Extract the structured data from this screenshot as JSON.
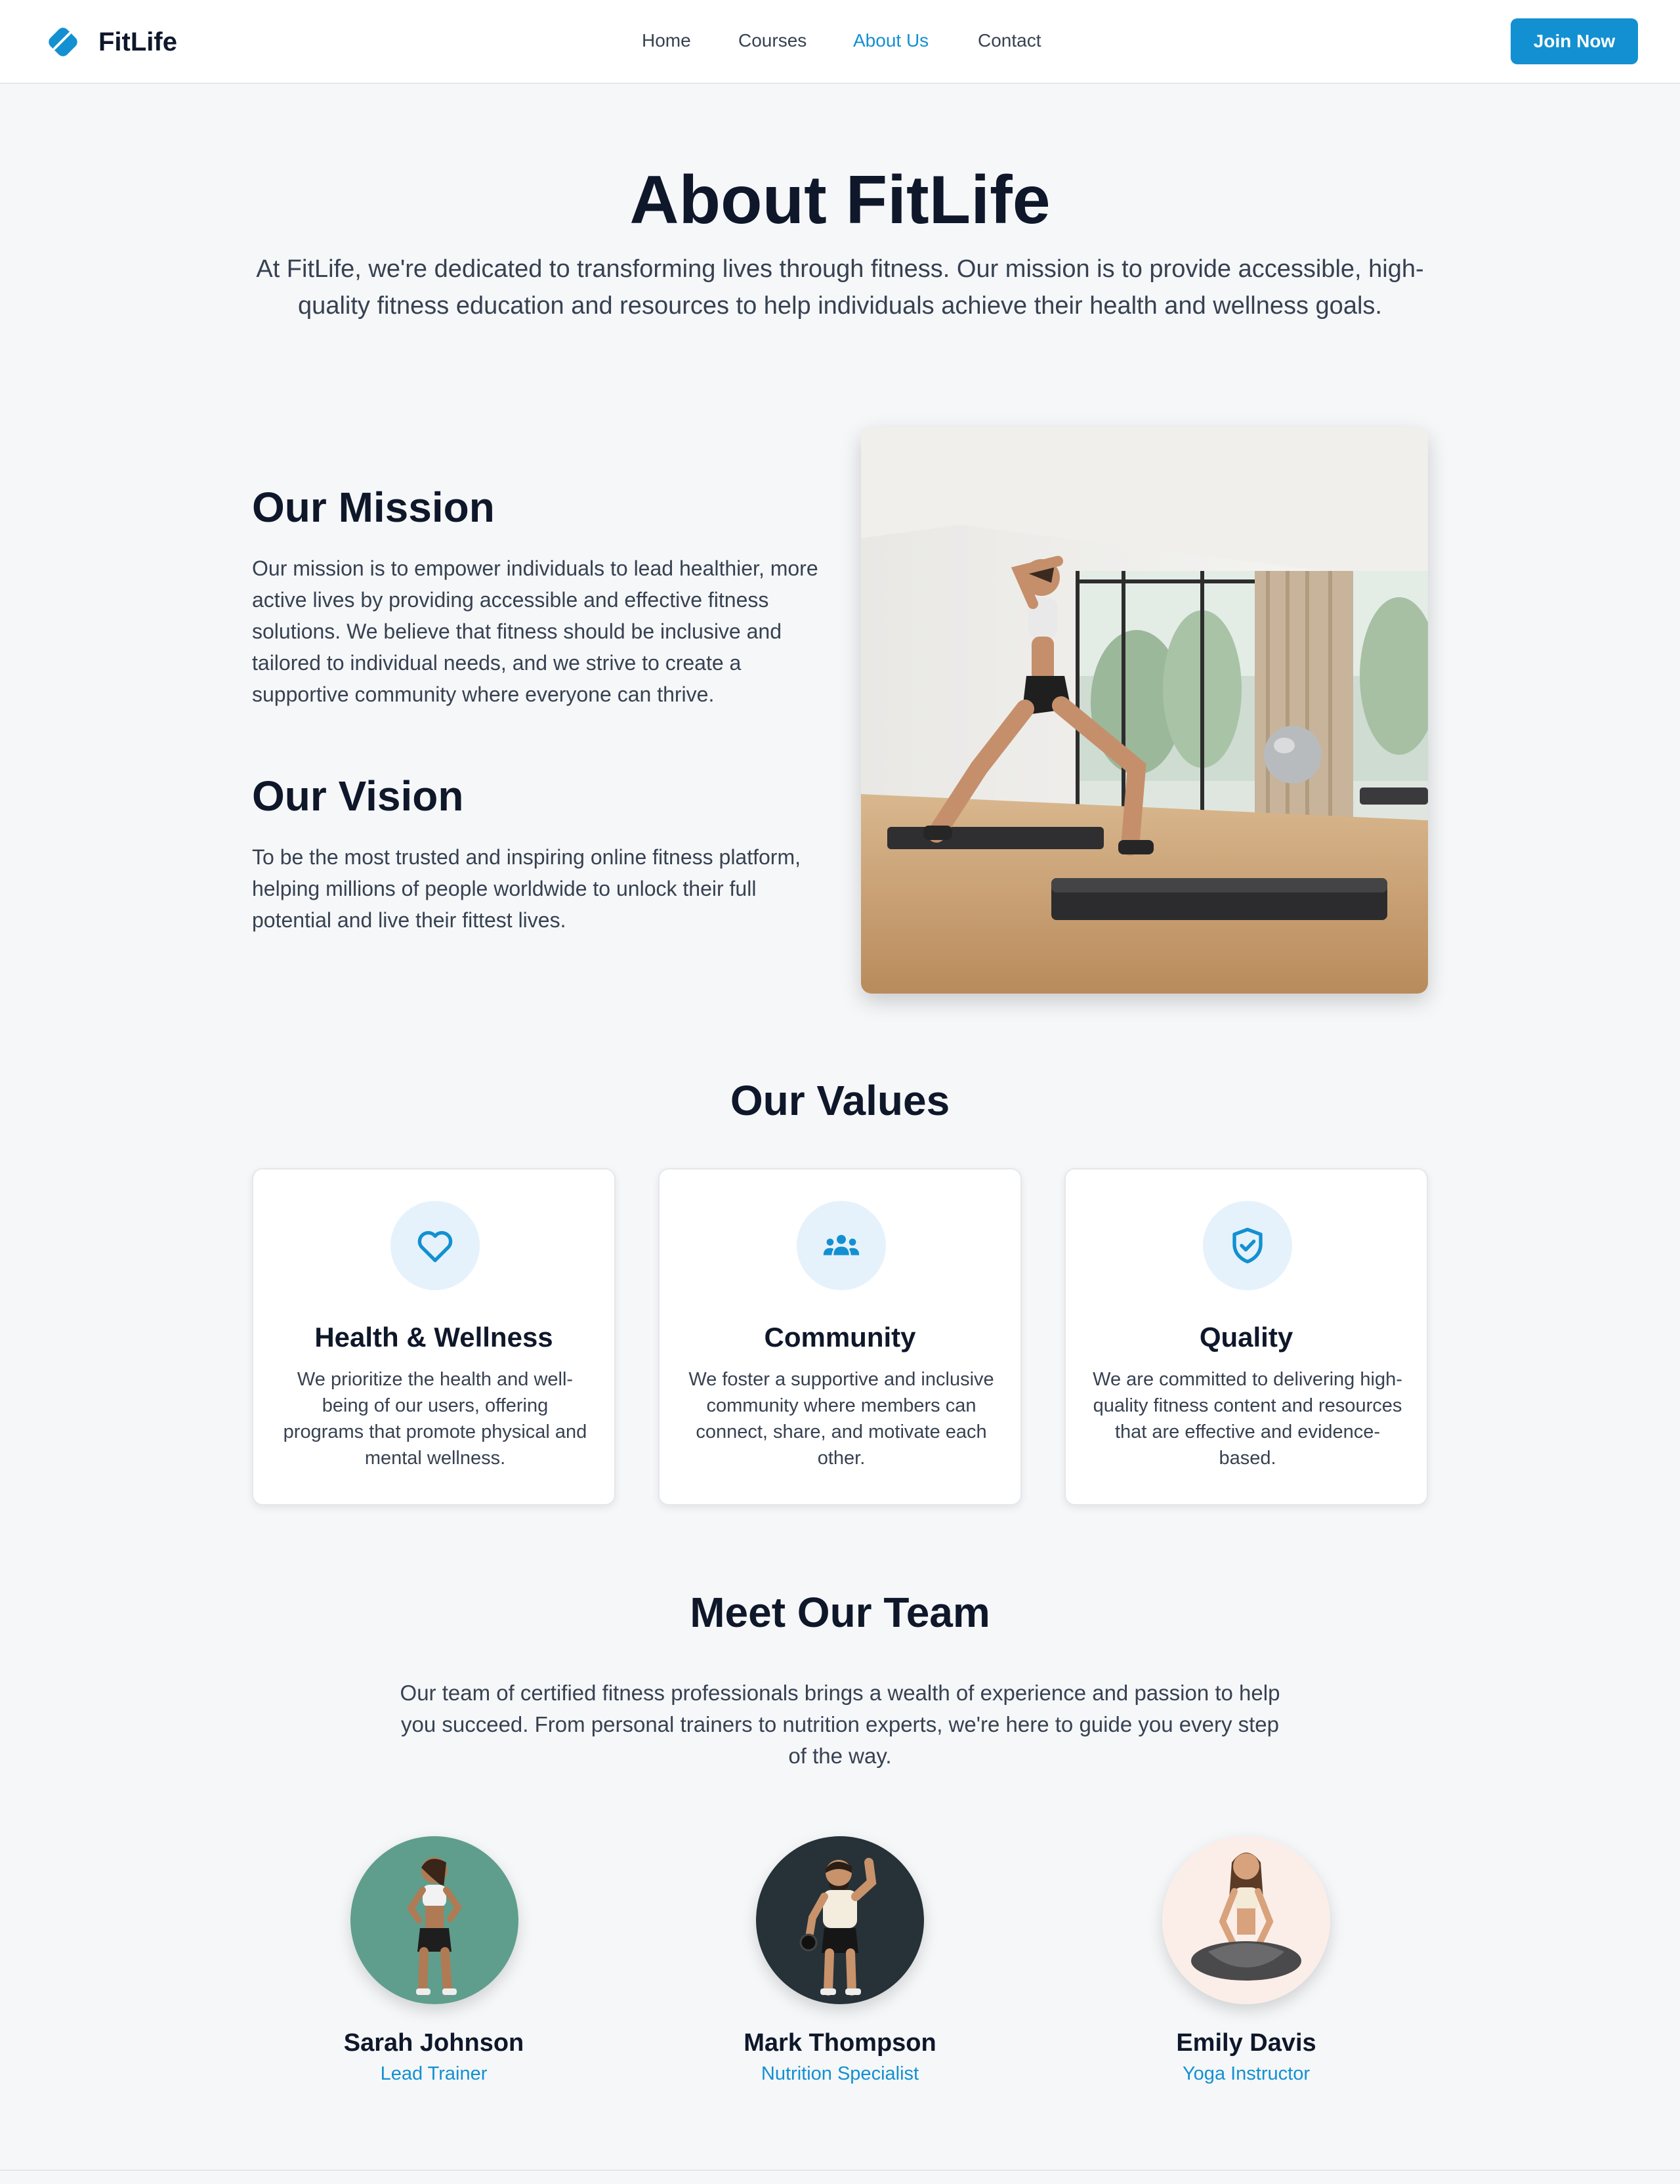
{
  "brand": {
    "name": "FitLife",
    "accent_color": "#1390d1",
    "logo_icon": "diamond-logo-icon"
  },
  "nav": {
    "items": [
      {
        "label": "Home",
        "active": false
      },
      {
        "label": "Courses",
        "active": false
      },
      {
        "label": "About Us",
        "active": true
      },
      {
        "label": "Contact",
        "active": false
      }
    ],
    "cta_label": "Join Now"
  },
  "hero": {
    "title": "About FitLife",
    "intro": "At FitLife, we're dedicated to transforming lives through fitness. Our mission is to provide accessible, high-quality fitness education and resources to help individuals achieve their health and wellness goals."
  },
  "mission": {
    "heading": "Our Mission",
    "text": "Our mission is to empower individuals to lead healthier, more active lives by providing accessible and effective fitness solutions. We believe that fitness should be inclusive and tailored to individual needs, and we strive to create a supportive community where everyone can thrive."
  },
  "vision": {
    "heading": "Our Vision",
    "text": "To be the most trusted and inspiring online fitness platform, helping millions of people worldwide to unlock their full potential and live their fittest lives."
  },
  "values": {
    "heading": "Our Values",
    "items": [
      {
        "icon": "heart-icon",
        "title": "Health & Wellness",
        "text": "We prioritize the health and well-being of our users, offering programs that promote physical and mental wellness."
      },
      {
        "icon": "people-group-icon",
        "title": "Community",
        "text": "We foster a supportive and inclusive community where members can connect, share, and motivate each other."
      },
      {
        "icon": "shield-check-icon",
        "title": "Quality",
        "text": "We are committed to delivering high-quality fitness content and resources that are effective and evidence-based."
      }
    ]
  },
  "team": {
    "heading": "Meet Our Team",
    "intro": "Our team of certified fitness professionals brings a wealth of experience and passion to help you succeed. From personal trainers to nutrition experts, we're here to guide you every step of the way.",
    "members": [
      {
        "name": "Sarah Johnson",
        "role": "Lead Trainer",
        "avatar_bg": "#5f9e8c"
      },
      {
        "name": "Mark Thompson",
        "role": "Nutrition Specialist",
        "avatar_bg": "#263238"
      },
      {
        "name": "Emily Davis",
        "role": "Yoga Instructor",
        "avatar_bg": "#fbeee8"
      }
    ]
  }
}
